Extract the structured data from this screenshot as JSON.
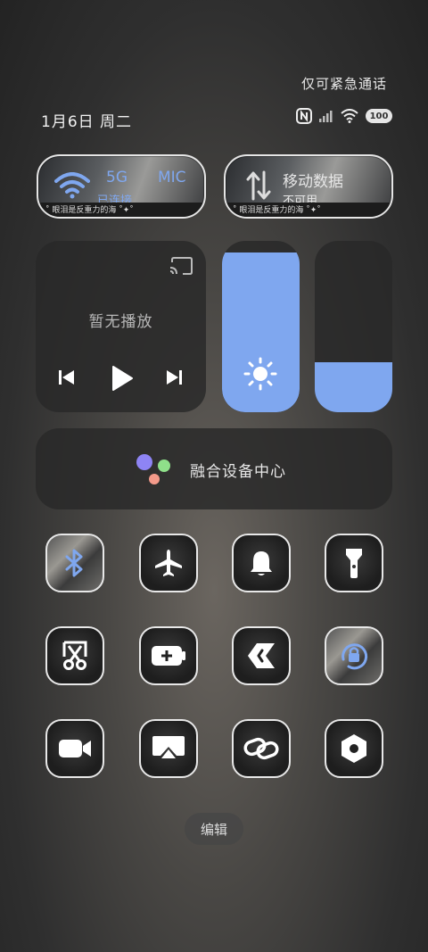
{
  "status": {
    "emergency_text": "仅可紧急通话",
    "date": "1月6日",
    "weekday": "周二",
    "battery_level": "100"
  },
  "connectivity": {
    "wifi": {
      "badge_5g": "5G",
      "badge_mic": "MIC",
      "status": "已连接",
      "caption": "˚ 眼泪是反重力的海 ˚✦˚"
    },
    "mobile_data": {
      "label": "移动数据",
      "status": "不可用",
      "caption": "˚ 眼泪是反重力的海 ˚✦˚"
    }
  },
  "media": {
    "status": "暂无播放"
  },
  "sliders": {
    "brightness_level": 0.93,
    "volume_level": 0.29
  },
  "device_center": {
    "label": "融合设备中心"
  },
  "tiles": [
    {
      "name": "bluetooth",
      "icon": "bluetooth-icon"
    },
    {
      "name": "airplane-mode",
      "icon": "airplane-icon"
    },
    {
      "name": "ring",
      "icon": "bell-icon"
    },
    {
      "name": "flashlight",
      "icon": "flashlight-icon"
    },
    {
      "name": "screenshot",
      "icon": "scissors-icon"
    },
    {
      "name": "battery-saver",
      "icon": "battery-plus-icon"
    },
    {
      "name": "share",
      "icon": "share-icon"
    },
    {
      "name": "rotation-lock",
      "icon": "rotation-lock-icon"
    },
    {
      "name": "screen-record",
      "icon": "video-camera-icon"
    },
    {
      "name": "projection",
      "icon": "cast-screen-icon"
    },
    {
      "name": "link",
      "icon": "link-icon"
    },
    {
      "name": "settings",
      "icon": "hexagon-icon"
    }
  ],
  "edit_button": "编辑",
  "colors": {
    "accent": "#7fa7ef",
    "tile_border": "#e8e8e8"
  }
}
